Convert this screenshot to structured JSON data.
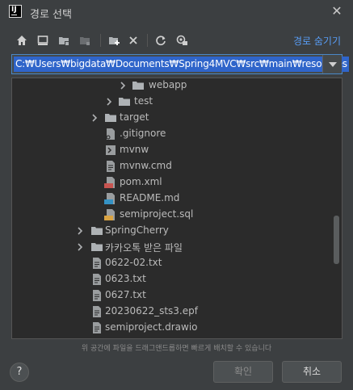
{
  "window": {
    "title": "경로 선택",
    "close_glyph": "✕"
  },
  "toolbar": {
    "hide_path_label": "경로 숨기기",
    "icons": [
      "home-icon",
      "desktop-icon",
      "project-folder-icon",
      "module-folder-icon",
      "new-folder-icon",
      "delete-icon",
      "refresh-icon",
      "show-hidden-icon"
    ]
  },
  "path": {
    "value": "C:₩Users₩bigdata₩Documents₩Spring4MVC₩src₩main₩resources"
  },
  "tree": {
    "items": [
      {
        "label": "webapp",
        "type": "folder",
        "expandable": true
      },
      {
        "label": "test",
        "type": "folder",
        "expandable": true
      },
      {
        "label": "target",
        "type": "folder",
        "expandable": true
      },
      {
        "label": ".gitignore",
        "type": "gitignore-file"
      },
      {
        "label": "mvnw",
        "type": "script-file"
      },
      {
        "label": "mvnw.cmd",
        "type": "text-file"
      },
      {
        "label": "pom.xml",
        "type": "xml-file"
      },
      {
        "label": "README.md",
        "type": "md-file"
      },
      {
        "label": "semiproject.sql",
        "type": "sql-file"
      },
      {
        "label": "SpringCherry",
        "type": "folder",
        "expandable": true
      },
      {
        "label": "카카오톡 받은 파일",
        "type": "folder",
        "expandable": true
      },
      {
        "label": "0622-02.txt",
        "type": "text-file"
      },
      {
        "label": "0623.txt",
        "type": "text-file"
      },
      {
        "label": "0627.txt",
        "type": "text-file"
      },
      {
        "label": "20230622_sts3.epf",
        "type": "text-file"
      },
      {
        "label": "semiproject.drawio",
        "type": "text-file"
      }
    ]
  },
  "footer": {
    "hint": "위 공간에 파일을 드래그앤드롭하면 빠르게 배치할 수 있습니다",
    "help_label": "?",
    "ok_label": "확인",
    "cancel_label": "취소"
  }
}
